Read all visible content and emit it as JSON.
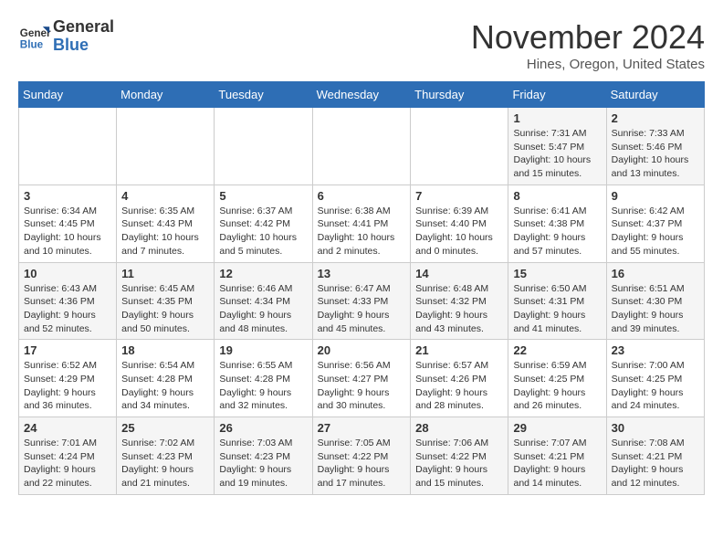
{
  "header": {
    "logo_general": "General",
    "logo_blue": "Blue",
    "month_title": "November 2024",
    "location": "Hines, Oregon, United States"
  },
  "weekdays": [
    "Sunday",
    "Monday",
    "Tuesday",
    "Wednesday",
    "Thursday",
    "Friday",
    "Saturday"
  ],
  "weeks": [
    [
      {
        "day": "",
        "info": ""
      },
      {
        "day": "",
        "info": ""
      },
      {
        "day": "",
        "info": ""
      },
      {
        "day": "",
        "info": ""
      },
      {
        "day": "",
        "info": ""
      },
      {
        "day": "1",
        "info": "Sunrise: 7:31 AM\nSunset: 5:47 PM\nDaylight: 10 hours and 15 minutes."
      },
      {
        "day": "2",
        "info": "Sunrise: 7:33 AM\nSunset: 5:46 PM\nDaylight: 10 hours and 13 minutes."
      }
    ],
    [
      {
        "day": "3",
        "info": "Sunrise: 6:34 AM\nSunset: 4:45 PM\nDaylight: 10 hours and 10 minutes."
      },
      {
        "day": "4",
        "info": "Sunrise: 6:35 AM\nSunset: 4:43 PM\nDaylight: 10 hours and 7 minutes."
      },
      {
        "day": "5",
        "info": "Sunrise: 6:37 AM\nSunset: 4:42 PM\nDaylight: 10 hours and 5 minutes."
      },
      {
        "day": "6",
        "info": "Sunrise: 6:38 AM\nSunset: 4:41 PM\nDaylight: 10 hours and 2 minutes."
      },
      {
        "day": "7",
        "info": "Sunrise: 6:39 AM\nSunset: 4:40 PM\nDaylight: 10 hours and 0 minutes."
      },
      {
        "day": "8",
        "info": "Sunrise: 6:41 AM\nSunset: 4:38 PM\nDaylight: 9 hours and 57 minutes."
      },
      {
        "day": "9",
        "info": "Sunrise: 6:42 AM\nSunset: 4:37 PM\nDaylight: 9 hours and 55 minutes."
      }
    ],
    [
      {
        "day": "10",
        "info": "Sunrise: 6:43 AM\nSunset: 4:36 PM\nDaylight: 9 hours and 52 minutes."
      },
      {
        "day": "11",
        "info": "Sunrise: 6:45 AM\nSunset: 4:35 PM\nDaylight: 9 hours and 50 minutes."
      },
      {
        "day": "12",
        "info": "Sunrise: 6:46 AM\nSunset: 4:34 PM\nDaylight: 9 hours and 48 minutes."
      },
      {
        "day": "13",
        "info": "Sunrise: 6:47 AM\nSunset: 4:33 PM\nDaylight: 9 hours and 45 minutes."
      },
      {
        "day": "14",
        "info": "Sunrise: 6:48 AM\nSunset: 4:32 PM\nDaylight: 9 hours and 43 minutes."
      },
      {
        "day": "15",
        "info": "Sunrise: 6:50 AM\nSunset: 4:31 PM\nDaylight: 9 hours and 41 minutes."
      },
      {
        "day": "16",
        "info": "Sunrise: 6:51 AM\nSunset: 4:30 PM\nDaylight: 9 hours and 39 minutes."
      }
    ],
    [
      {
        "day": "17",
        "info": "Sunrise: 6:52 AM\nSunset: 4:29 PM\nDaylight: 9 hours and 36 minutes."
      },
      {
        "day": "18",
        "info": "Sunrise: 6:54 AM\nSunset: 4:28 PM\nDaylight: 9 hours and 34 minutes."
      },
      {
        "day": "19",
        "info": "Sunrise: 6:55 AM\nSunset: 4:28 PM\nDaylight: 9 hours and 32 minutes."
      },
      {
        "day": "20",
        "info": "Sunrise: 6:56 AM\nSunset: 4:27 PM\nDaylight: 9 hours and 30 minutes."
      },
      {
        "day": "21",
        "info": "Sunrise: 6:57 AM\nSunset: 4:26 PM\nDaylight: 9 hours and 28 minutes."
      },
      {
        "day": "22",
        "info": "Sunrise: 6:59 AM\nSunset: 4:25 PM\nDaylight: 9 hours and 26 minutes."
      },
      {
        "day": "23",
        "info": "Sunrise: 7:00 AM\nSunset: 4:25 PM\nDaylight: 9 hours and 24 minutes."
      }
    ],
    [
      {
        "day": "24",
        "info": "Sunrise: 7:01 AM\nSunset: 4:24 PM\nDaylight: 9 hours and 22 minutes."
      },
      {
        "day": "25",
        "info": "Sunrise: 7:02 AM\nSunset: 4:23 PM\nDaylight: 9 hours and 21 minutes."
      },
      {
        "day": "26",
        "info": "Sunrise: 7:03 AM\nSunset: 4:23 PM\nDaylight: 9 hours and 19 minutes."
      },
      {
        "day": "27",
        "info": "Sunrise: 7:05 AM\nSunset: 4:22 PM\nDaylight: 9 hours and 17 minutes."
      },
      {
        "day": "28",
        "info": "Sunrise: 7:06 AM\nSunset: 4:22 PM\nDaylight: 9 hours and 15 minutes."
      },
      {
        "day": "29",
        "info": "Sunrise: 7:07 AM\nSunset: 4:21 PM\nDaylight: 9 hours and 14 minutes."
      },
      {
        "day": "30",
        "info": "Sunrise: 7:08 AM\nSunset: 4:21 PM\nDaylight: 9 hours and 12 minutes."
      }
    ]
  ]
}
